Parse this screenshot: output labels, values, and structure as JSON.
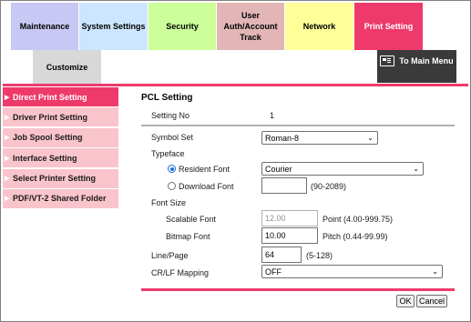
{
  "tabs": {
    "maintenance": "Maintenance",
    "system_settings": "System Settings",
    "security": "Security",
    "user_auth": "User Auth/Account Track",
    "network": "Network",
    "print_setting": "Print Setting",
    "customize": "Customize"
  },
  "to_main_menu": "To Main Menu",
  "sidebar": {
    "items": [
      {
        "label": "Direct Print Setting"
      },
      {
        "label": "Driver Print Setting"
      },
      {
        "label": "Job Spool Setting"
      },
      {
        "label": "Interface Setting"
      },
      {
        "label": "Select Printer Setting"
      },
      {
        "label": "PDF/VT-2 Shared Folder"
      }
    ]
  },
  "section": {
    "title": "PCL Setting",
    "setting_no_label": "Setting No",
    "setting_no_value": "1",
    "symbol_set_label": "Symbol Set",
    "symbol_set_value": "Roman-8",
    "typeface_label": "Typeface",
    "resident_font_label": "Resident Font",
    "resident_font_value": "Courier",
    "download_font_label": "Download Font",
    "download_font_value": "",
    "download_font_range": "(90-2089)",
    "font_size_label": "Font Size",
    "scalable_font_label": "Scalable Font",
    "scalable_font_value": "12.00",
    "scalable_font_unit": "Point (4.00-999.75)",
    "bitmap_font_label": "Bitmap Font",
    "bitmap_font_value": "10.00",
    "bitmap_font_unit": "Pitch (0.44-99.99)",
    "line_page_label": "Line/Page",
    "line_page_value": "64",
    "line_page_range": "(5-128)",
    "crlf_label": "CR/LF Mapping",
    "crlf_value": "OFF"
  },
  "buttons": {
    "ok": "OK",
    "cancel": "Cancel"
  },
  "colors": {
    "accent": "#ee3a6a",
    "sidebar_bg": "#f9c4cc"
  }
}
